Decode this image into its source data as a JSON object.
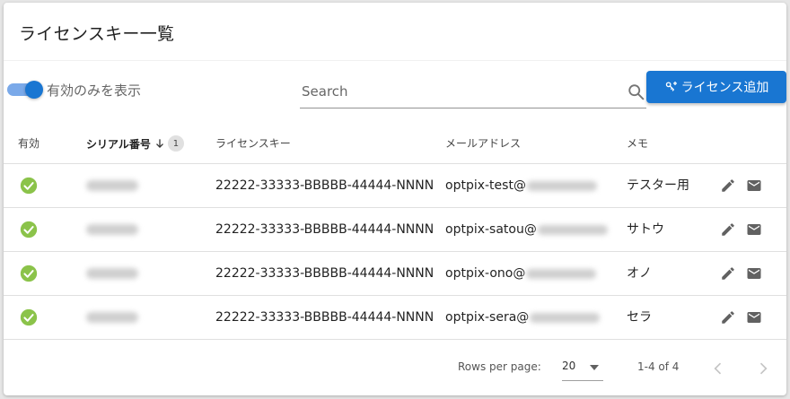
{
  "page": {
    "title": "ライセンスキー一覧"
  },
  "toolbar": {
    "toggle_label": "有効のみを表示",
    "toggle_on": true,
    "search_placeholder": "Search",
    "add_button_label": "ライセンス追加"
  },
  "table": {
    "headers": {
      "active": "有効",
      "serial": "シリアル番号",
      "serial_sort_index": "1",
      "license_key": "ライセンスキー",
      "email": "メールアドレス",
      "memo": "メモ"
    },
    "rows": [
      {
        "active": true,
        "license_key": "22222-33333-BBBBB-44444-NNNN",
        "email_prefix": "optpix-test@",
        "memo": "テスター用"
      },
      {
        "active": true,
        "license_key": "22222-33333-BBBBB-44444-NNNN",
        "email_prefix": "optpix-satou@",
        "memo": "サトウ"
      },
      {
        "active": true,
        "license_key": "22222-33333-BBBBB-44444-NNNN",
        "email_prefix": "optpix-ono@",
        "memo": "オノ"
      },
      {
        "active": true,
        "license_key": "22222-33333-BBBBB-44444-NNNN",
        "email_prefix": "optpix-sera@",
        "memo": "セラ"
      }
    ]
  },
  "footer": {
    "rows_per_page_label": "Rows per page:",
    "rows_per_page_value": "20",
    "range_text": "1-4 of 4"
  },
  "icons": {
    "active": "check-circle-icon",
    "edit": "pencil-icon",
    "mail": "mail-icon",
    "search": "search-icon",
    "add": "key-plus-icon",
    "sort": "arrow-down-icon",
    "prev": "chevron-left-icon",
    "next": "chevron-right-icon"
  },
  "colors": {
    "primary": "#1976d2",
    "toggle_track": "#7aa9e9",
    "active_check": "#8bc34a",
    "action_icon": "#616161"
  }
}
